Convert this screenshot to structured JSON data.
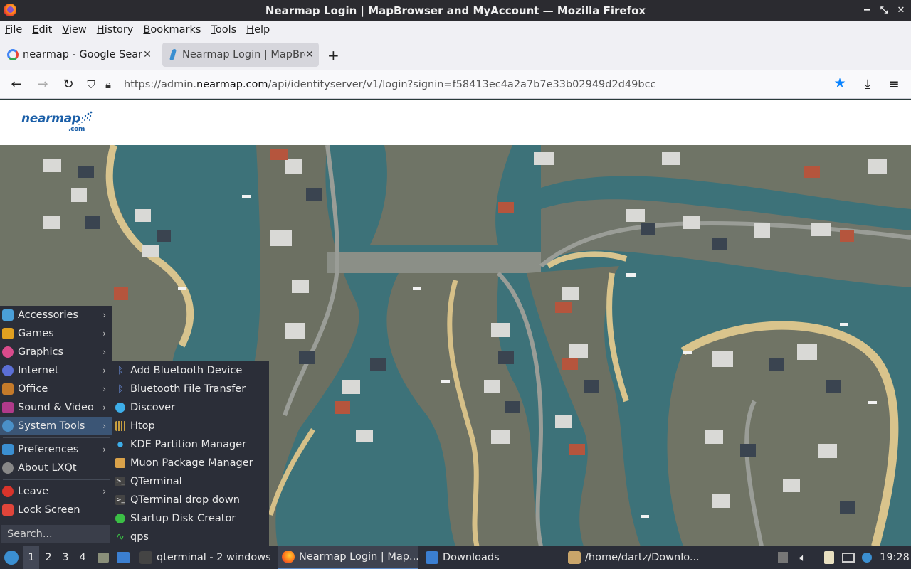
{
  "window": {
    "title": "Nearmap Login | MapBrowser and MyAccount — Mozilla Firefox"
  },
  "menubar": [
    "File",
    "Edit",
    "View",
    "History",
    "Bookmarks",
    "Tools",
    "Help"
  ],
  "tabs": [
    {
      "label": "nearmap - Google Search"
    },
    {
      "label": "Nearmap Login | MapBrowser and MyAccount"
    }
  ],
  "url": {
    "prefix": "https://admin.",
    "domain": "nearmap.com",
    "suffix": "/api/identityserver/v1/login?signin=f58413ec4a2a7b7e33b02949d2d49bcc"
  },
  "page": {
    "logo_text": "nearmap",
    "logo_suffix": ".com"
  },
  "start_menu": {
    "items": [
      {
        "label": "Accessories",
        "icon": "accessories-icon",
        "color": "#4a9fd8"
      },
      {
        "label": "Games",
        "icon": "games-icon",
        "color": "#e0a020"
      },
      {
        "label": "Graphics",
        "icon": "graphics-icon",
        "color": "#d94b8c"
      },
      {
        "label": "Internet",
        "icon": "internet-icon",
        "color": "#5b6fd6"
      },
      {
        "label": "Office",
        "icon": "office-icon",
        "color": "#c47a2a"
      },
      {
        "label": "Sound & Video",
        "icon": "sound-video-icon",
        "color": "#b03a8a"
      },
      {
        "label": "System Tools",
        "icon": "system-tools-icon",
        "color": "#4a90c8"
      },
      {
        "label": "Preferences",
        "icon": "preferences-icon",
        "color": "#3b8fd1"
      },
      {
        "label": "About LXQt",
        "icon": "about-icon",
        "color": "#888888"
      },
      {
        "label": "Leave",
        "icon": "leave-icon",
        "color": "#d9342b"
      },
      {
        "label": "Lock Screen",
        "icon": "lock-icon",
        "color": "#e0453a"
      }
    ],
    "search_placeholder": "Search..."
  },
  "submenu": {
    "items": [
      {
        "label": "Add Bluetooth Device",
        "icon": "bluetooth-icon"
      },
      {
        "label": "Bluetooth File Transfer",
        "icon": "bluetooth-icon"
      },
      {
        "label": "Discover",
        "icon": "discover-icon"
      },
      {
        "label": "Htop",
        "icon": "htop-icon"
      },
      {
        "label": "KDE Partition Manager",
        "icon": "partition-icon"
      },
      {
        "label": "Muon Package Manager",
        "icon": "package-icon"
      },
      {
        "label": "QTerminal",
        "icon": "terminal-icon"
      },
      {
        "label": "QTerminal drop down",
        "icon": "terminal-icon"
      },
      {
        "label": "Startup Disk Creator",
        "icon": "disk-creator-icon"
      },
      {
        "label": "qps",
        "icon": "qps-icon"
      }
    ]
  },
  "taskbar": {
    "desktops": [
      "1",
      "2",
      "3",
      "4"
    ],
    "tasks": [
      {
        "label": "qterminal - 2 windows"
      },
      {
        "label": "Nearmap Login | Map..."
      },
      {
        "label": "Downloads"
      },
      {
        "label": "/home/dartz/Downlo..."
      }
    ],
    "clock": "19:28"
  }
}
